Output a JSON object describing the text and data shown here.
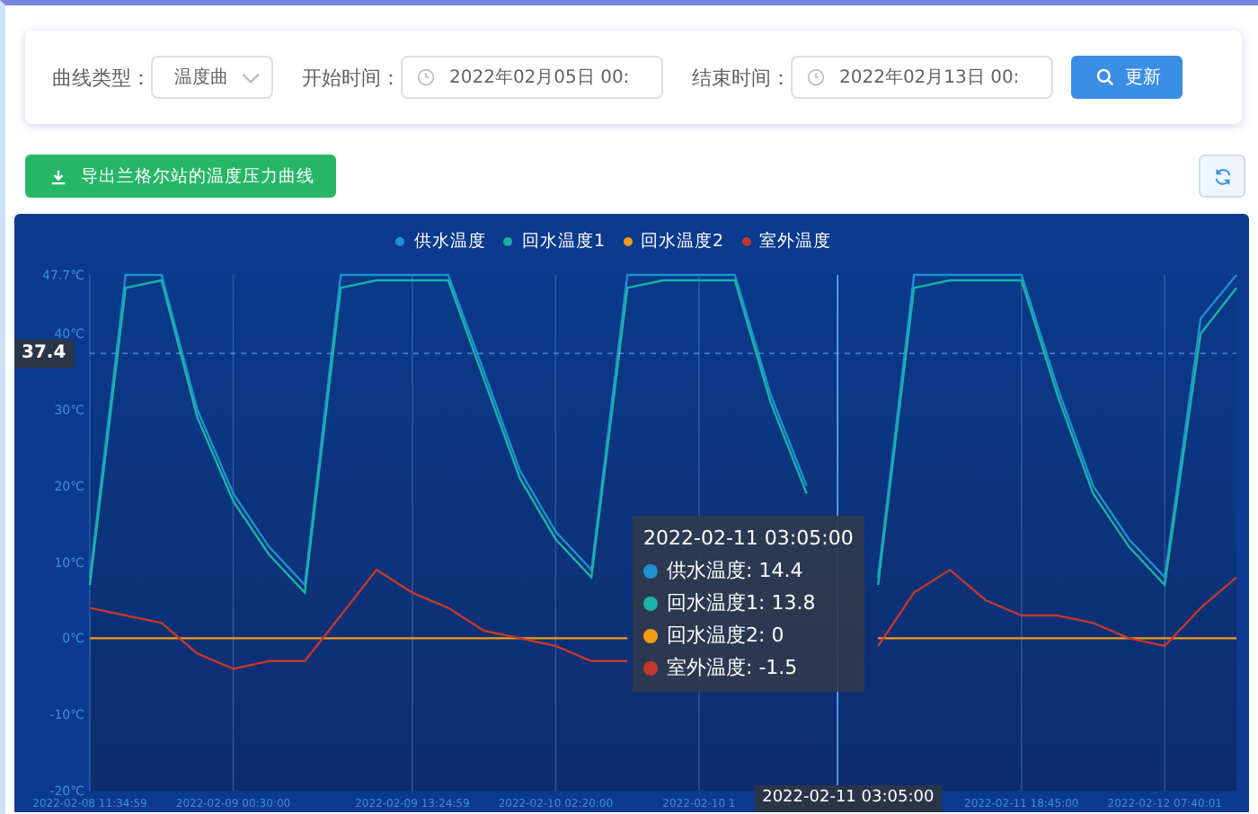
{
  "filters": {
    "curve_type": {
      "label": "曲线类型：",
      "value": "温度曲"
    },
    "start_time": {
      "label": "开始时间：",
      "value": "2022年02月05日 00:"
    },
    "end_time": {
      "label": "结束时间：",
      "value": "2022年02月13日 00:"
    },
    "update_button": "更新"
  },
  "export_button": "导出兰格尔站的温度压力曲线",
  "chart": {
    "chart_data": {
      "type": "line",
      "grid": true,
      "ylim": [
        -20,
        47.7
      ],
      "ref_lines": [
        {
          "axis": "y",
          "value": 37.4,
          "label": "37.4"
        }
      ],
      "categories": [
        "2022-02-08 11:34:59",
        null,
        null,
        null,
        "2022-02-09 00:30:00",
        null,
        null,
        null,
        null,
        "2022-02-09 13:24:59",
        null,
        null,
        null,
        "2022-02-10 02:20:00",
        null,
        null,
        null,
        "2022-02-10 1",
        null,
        null,
        null,
        null,
        null,
        null,
        null,
        null,
        "2022-02-11 18:45:00",
        null,
        null,
        null,
        "2022-02-12 07:40:01",
        null,
        null
      ],
      "series": [
        {
          "name": "供水温度",
          "color": "#1e90d0",
          "values": [
            8,
            47.7,
            47.7,
            30,
            19,
            12,
            7,
            47.7,
            47.7,
            47.7,
            47.7,
            35,
            22,
            14,
            9,
            47.7,
            47.7,
            47.7,
            47.7,
            32,
            20,
            null,
            8,
            47.7,
            47.7,
            47.7,
            47.7,
            33,
            20,
            13,
            8,
            42,
            47.7
          ]
        },
        {
          "name": "回水温度1",
          "color": "#1ab3a6",
          "values": [
            7,
            46,
            47,
            29,
            18,
            11,
            6,
            46,
            47,
            47,
            47,
            34,
            21,
            13,
            8,
            46,
            47,
            47,
            47,
            31,
            19,
            null,
            7,
            46,
            47,
            47,
            47,
            32,
            19,
            12,
            7,
            40,
            46
          ]
        },
        {
          "name": "回水温度2",
          "color": "#f39c12",
          "values": [
            0,
            0,
            0,
            0,
            0,
            0,
            0,
            0,
            0,
            0,
            0,
            0,
            0,
            0,
            0,
            0,
            null,
            null,
            null,
            null,
            null,
            null,
            0,
            0,
            0,
            0,
            0,
            0,
            0,
            0,
            0,
            0,
            0
          ]
        },
        {
          "name": "室外温度",
          "color": "#c0392b",
          "values": [
            4,
            3,
            2,
            -2,
            -4,
            -3,
            -3,
            3,
            9,
            6,
            4,
            1,
            0,
            -1,
            -3,
            -3,
            null,
            null,
            null,
            null,
            null,
            null,
            -1,
            6,
            9,
            5,
            3,
            3,
            2,
            0,
            -1,
            4,
            8
          ]
        }
      ],
      "yticks": [
        {
          "value": 47.7,
          "label": "47.7℃"
        },
        {
          "value": 40,
          "label": "40℃"
        },
        {
          "value": 30,
          "label": "30℃"
        },
        {
          "value": 20,
          "label": "20℃"
        },
        {
          "value": 10,
          "label": "10℃"
        },
        {
          "value": 0,
          "label": "0℃"
        },
        {
          "value": -10,
          "label": "-10℃"
        },
        {
          "value": -20,
          "label": "-20℃"
        }
      ]
    },
    "x_pointer_label": "2022-02-11 03:05:00",
    "tooltip": {
      "title": "2022-02-11 03:05:00",
      "rows": [
        {
          "text": "供水温度: 14.4",
          "color": "#1e90d0"
        },
        {
          "text": "回水温度1: 13.8",
          "color": "#1ab3a6"
        },
        {
          "text": "回水温度2: 0",
          "color": "#f39c12"
        },
        {
          "text": "室外温度: -1.5",
          "color": "#c0392b"
        }
      ]
    }
  }
}
